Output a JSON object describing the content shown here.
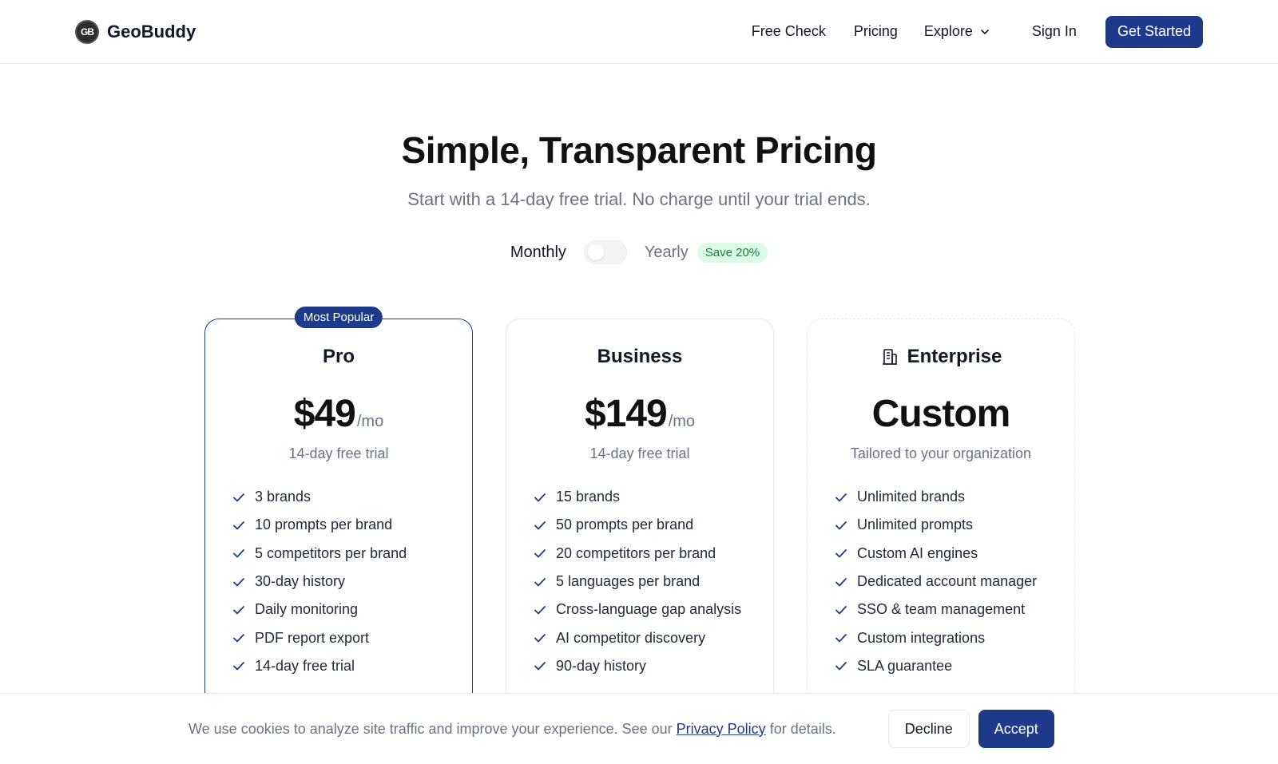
{
  "brand": {
    "logo_text": "GB",
    "name": "GeoBuddy"
  },
  "nav": {
    "free_check": "Free Check",
    "pricing": "Pricing",
    "explore": "Explore",
    "sign_in": "Sign In",
    "get_started": "Get Started"
  },
  "hero": {
    "title": "Simple, Transparent Pricing",
    "subtitle": "Start with a 14-day free trial. No charge until your trial ends."
  },
  "billing": {
    "monthly": "Monthly",
    "yearly": "Yearly",
    "save_badge": "Save 20%",
    "selected": "Monthly"
  },
  "plans": [
    {
      "name": "Pro",
      "badge": "Most Popular",
      "price": "$49",
      "unit": "/mo",
      "note": "14-day free trial",
      "features": [
        "3 brands",
        "10 prompts per brand",
        "5 competitors per brand",
        "30-day history",
        "Daily monitoring",
        "PDF report export",
        "14-day free trial"
      ]
    },
    {
      "name": "Business",
      "price": "$149",
      "unit": "/mo",
      "note": "14-day free trial",
      "features": [
        "15 brands",
        "50 prompts per brand",
        "20 competitors per brand",
        "5 languages per brand",
        "Cross-language gap analysis",
        "AI competitor discovery",
        "90-day history"
      ]
    },
    {
      "name": "Enterprise",
      "icon": "building-icon",
      "price": "Custom",
      "note": "Tailored to your organization",
      "features": [
        "Unlimited brands",
        "Unlimited prompts",
        "Custom AI engines",
        "Dedicated account manager",
        "SSO & team management",
        "Custom integrations",
        "SLA guarantee"
      ]
    }
  ],
  "cookie": {
    "text_before": "We use cookies to analyze site traffic and improve your experience. See our ",
    "link": "Privacy Policy",
    "text_after": " for details.",
    "decline": "Decline",
    "accept": "Accept"
  },
  "colors": {
    "primary": "#1e3a8a",
    "badge_green_bg": "#dcfce7",
    "badge_green_text": "#15803d"
  }
}
